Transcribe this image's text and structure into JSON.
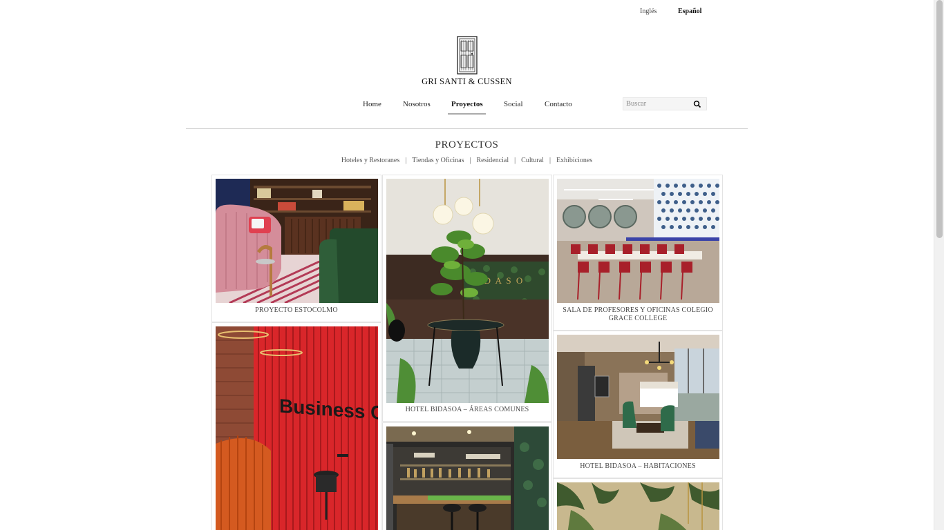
{
  "language": {
    "english": "Inglés",
    "spanish": "Español",
    "active": "Español"
  },
  "brand": {
    "name": "GRI SANTI & CUSSEN",
    "logo_icon": "door-icon"
  },
  "nav": {
    "items": [
      "Home",
      "Nosotros",
      "Proyectos",
      "Social",
      "Contacto"
    ],
    "active": "Proyectos"
  },
  "search": {
    "placeholder": "Buscar",
    "value": "",
    "icon": "search-icon"
  },
  "section": {
    "title": "PROYECTOS",
    "filters": [
      "Hoteles y Restoranes",
      "Tiendas y Oficinas",
      "Residencial",
      "Cultural",
      "Exhibiciones"
    ],
    "separator": "|"
  },
  "projects": [
    {
      "title": "PROYECTO ESTOCOLMO"
    },
    {
      "title": ""
    },
    {
      "title": "HOTEL BIDASOA – ÁREAS COMUNES"
    },
    {
      "title": ""
    },
    {
      "title": "SALA DE PROFESORES Y OFICINAS COLEGIO GRACE COLLEGE"
    },
    {
      "title": "HOTEL BIDASOA – HABITACIONES"
    },
    {
      "title": ""
    }
  ],
  "image_texts": {
    "business_center_sign": "Business Cent"
  },
  "colors": {
    "background": "#ffffff",
    "text": "#333333",
    "rule": "#cfcfcf",
    "nav_active_underline": "#aaaaaa"
  }
}
